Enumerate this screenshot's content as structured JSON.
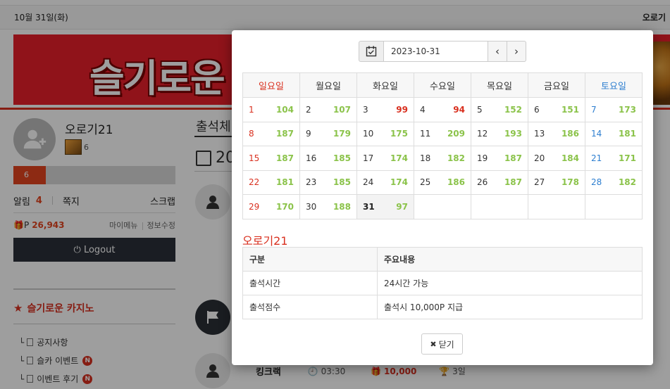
{
  "header": {
    "date": "10월 31일(화)",
    "user": "오로기"
  },
  "banner": {
    "title": "슬기로운"
  },
  "profile": {
    "username": "오로기21",
    "level": "6",
    "level_bar_label": "6",
    "level_progress": 0.2,
    "alarm_label": "알림",
    "alarm_count": "4",
    "message_label": "쪽지",
    "scrap_label": "스크랩",
    "point_label": "P",
    "point_value": "26,943",
    "mymenu_label": "마이메뉴",
    "edit_label": "정보수정",
    "logout_label": "Logout"
  },
  "sidebar": {
    "section_title": "슬기로운 카지노",
    "items": [
      {
        "label": "공지사항",
        "badge": ""
      },
      {
        "label": "슬카 이벤트",
        "badge": "N"
      },
      {
        "label": "이벤트 후기",
        "badge": "N"
      }
    ]
  },
  "content": {
    "title": "출석체",
    "year": "20",
    "bottom_row": {
      "name": "킹크랙",
      "time": "03:30",
      "points": "10,000",
      "days": "3일"
    }
  },
  "modal": {
    "date_value": "2023-10-31",
    "weekdays": [
      "일요일",
      "월요일",
      "화요일",
      "수요일",
      "목요일",
      "금요일",
      "토요일"
    ],
    "weeks": [
      [
        [
          "1",
          "104"
        ],
        [
          "2",
          "107"
        ],
        [
          "3",
          "99"
        ],
        [
          "4",
          "94"
        ],
        [
          "5",
          "152"
        ],
        [
          "6",
          "151"
        ],
        [
          "7",
          "173"
        ]
      ],
      [
        [
          "8",
          "187"
        ],
        [
          "9",
          "179"
        ],
        [
          "10",
          "175"
        ],
        [
          "11",
          "209"
        ],
        [
          "12",
          "193"
        ],
        [
          "13",
          "186"
        ],
        [
          "14",
          "181"
        ]
      ],
      [
        [
          "15",
          "187"
        ],
        [
          "16",
          "185"
        ],
        [
          "17",
          "174"
        ],
        [
          "18",
          "182"
        ],
        [
          "19",
          "187"
        ],
        [
          "20",
          "184"
        ],
        [
          "21",
          "171"
        ]
      ],
      [
        [
          "22",
          "181"
        ],
        [
          "23",
          "185"
        ],
        [
          "24",
          "174"
        ],
        [
          "25",
          "186"
        ],
        [
          "26",
          "187"
        ],
        [
          "27",
          "178"
        ],
        [
          "28",
          "182"
        ]
      ],
      [
        [
          "29",
          "170"
        ],
        [
          "30",
          "188"
        ],
        [
          "31",
          "97"
        ],
        null,
        null,
        null,
        null
      ]
    ],
    "today": "31",
    "red_counts": [
      "99",
      "94"
    ],
    "user_title": "오로기21",
    "info_headers": [
      "구분",
      "주요내용"
    ],
    "info_rows": [
      [
        "출석시간",
        "24시간 가능"
      ],
      [
        "출석점수",
        "출석시 10,000P 지급"
      ]
    ],
    "close_label": "닫기"
  },
  "colors": {
    "accent_red": "#d9301f",
    "saturday_blue": "#2e7fd0",
    "count_green": "#8bc34a",
    "dark_button": "#2a3039"
  }
}
